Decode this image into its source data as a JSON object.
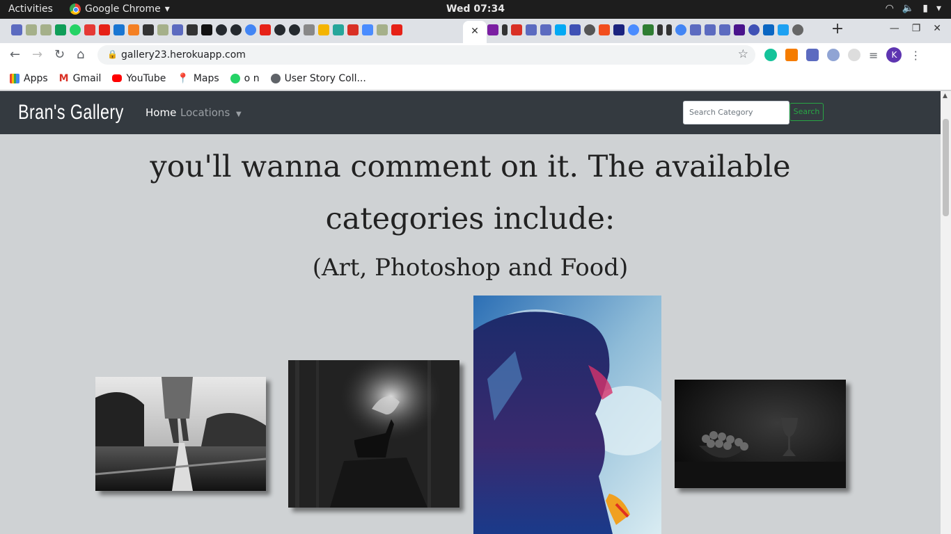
{
  "system": {
    "activities": "Activities",
    "app_name": "Google Chrome",
    "clock": "Wed 07:34"
  },
  "browser": {
    "url": "gallery23.herokuapp.com",
    "avatar_letter": "K"
  },
  "bookmarks": [
    {
      "label": "Apps",
      "color": "#e94235"
    },
    {
      "label": "Gmail",
      "color": "#d93025"
    },
    {
      "label": "YouTube",
      "color": "#ff0000"
    },
    {
      "label": "Maps",
      "color": "#34a853"
    },
    {
      "label": "o n",
      "color": "#25d366"
    },
    {
      "label": "User Story Coll...",
      "color": "#5f6368"
    }
  ],
  "site": {
    "brand": "Bran's Gallery",
    "nav_home": "Home",
    "nav_locations": "Locations",
    "search_placeholder": "Search Category",
    "search_button": "Search",
    "heading_line1": "you'll wanna comment on it. The available",
    "heading_line2": "categories include:",
    "categories_text": "(Art, Photoshop and Food)"
  },
  "photos": [
    {
      "name": "railway-walker-photo",
      "alt": "black and white person walking on railway"
    },
    {
      "name": "deer-photo",
      "alt": "deer with glowing antlers in dark forest"
    },
    {
      "name": "double-exposure-photo",
      "alt": "double exposure portrait with city"
    },
    {
      "name": "still-life-photo",
      "alt": "grapes and goblet still life"
    }
  ]
}
